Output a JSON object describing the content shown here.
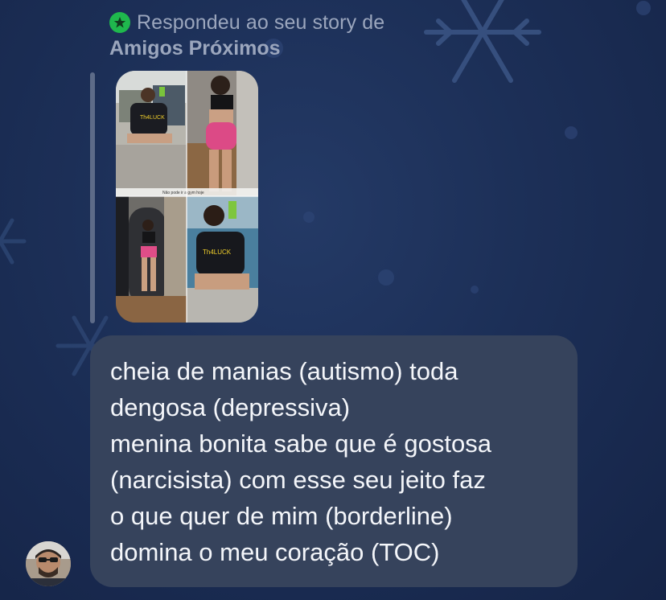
{
  "reply_header": {
    "icon": "green-star-icon",
    "line1": "Respondeu ao seu story de",
    "line2": "Amigos Próximos"
  },
  "story_thumbnail": {
    "caption": "Não pode ir a gym hoje",
    "shirt_text_top": "Th4LUCK",
    "shirt_text_bottom": "Th4LUCK"
  },
  "message": {
    "lines": [
      "cheia de manias (autismo) toda",
      "dengosa (depressiva)",
      "menina bonita sabe que é gostosa",
      "(narcisista) com esse seu jeito faz",
      "o que quer de mim (borderline)",
      "domina o meu coração (TOC)"
    ]
  },
  "colors": {
    "background": "#1c2f57",
    "bubble": "#36435c",
    "badge_green": "#1fb84d",
    "muted_text": "#9ba6bd"
  }
}
